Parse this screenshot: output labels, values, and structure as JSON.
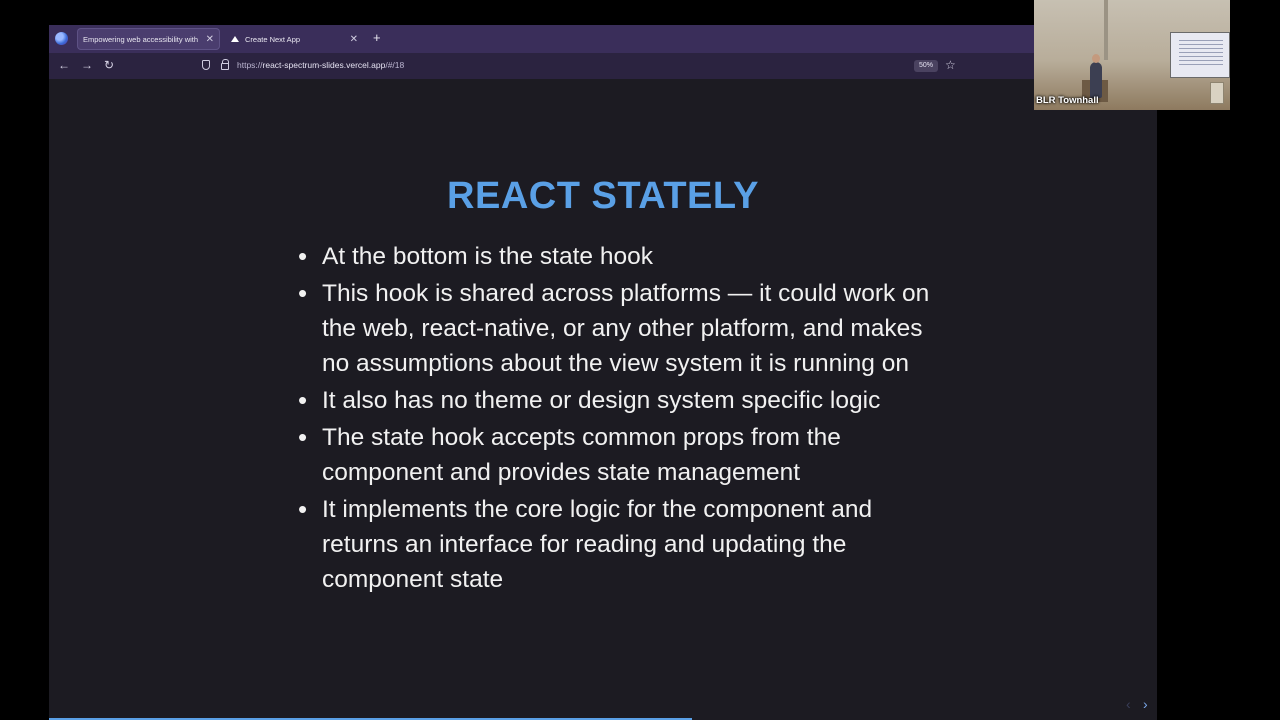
{
  "browser": {
    "tabs": [
      {
        "label": "Empowering web accessibility with",
        "active": true
      },
      {
        "label": "Create Next App",
        "active": false
      }
    ],
    "url_scheme": "https://",
    "url_host": "react-spectrum-slides.vercel.app",
    "url_path": "/#/18",
    "zoom": "50%",
    "icons": [
      "firefox-icon",
      "back-icon",
      "forward-icon",
      "reload-icon",
      "shield-icon",
      "lock-icon",
      "star-icon",
      "new-tab-icon",
      "close-icon"
    ]
  },
  "slide": {
    "title": "REACT STATELY",
    "bullets": [
      "At the bottom is the state hook",
      "This hook is shared across platforms — it could work on the web, react-native, or any other platform, and makes no assumptions about the view system it is running on",
      "It also has no theme or design system specific logic",
      "The state hook accepts common props from the component and provides state management",
      "It implements the core logic for the component and returns an interface for reading and updating the component state"
    ],
    "progress": 0.58,
    "accent_color": "#5aa0e6"
  },
  "webcam": {
    "label": "BLR Townhall"
  }
}
